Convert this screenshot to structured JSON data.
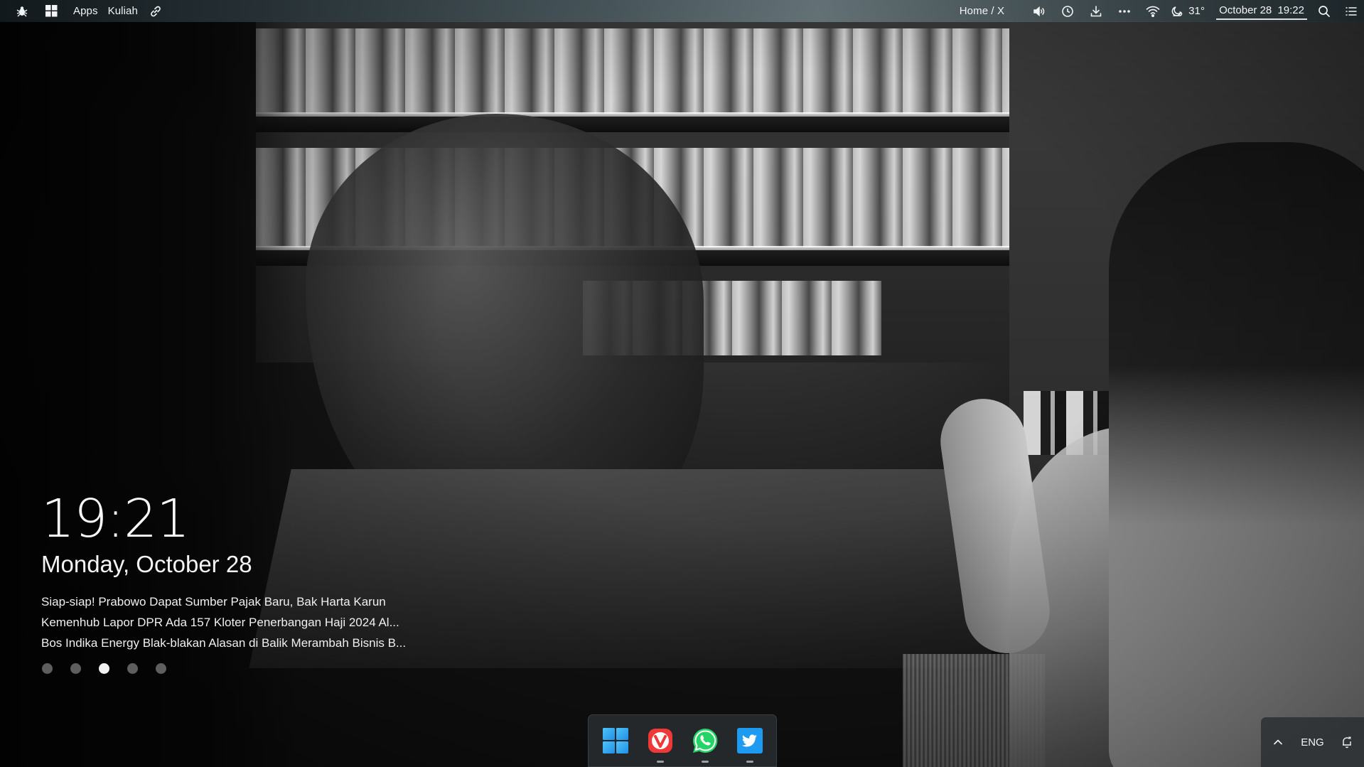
{
  "topbar": {
    "apps_label": "Apps",
    "kuliah_label": "Kuliah",
    "breadcrumb": "Home / X",
    "temperature": "31°",
    "date": "October 28",
    "time": "19:22"
  },
  "widget": {
    "time": "19:21",
    "date": "Monday, October 28",
    "news": [
      "Siap-siap! Prabowo Dapat Sumber Pajak Baru, Bak Harta Karun",
      "Kemenhub Lapor DPR Ada 157 Kloter Penerbangan Haji 2024 Al...",
      "Bos Indika Energy Blak-blakan Alasan di Balik Merambah Bisnis B..."
    ],
    "active_page": 3,
    "page_count": 5
  },
  "taskbar": {
    "apps": [
      {
        "icon": "windows-start-icon"
      },
      {
        "icon": "vivaldi-icon"
      },
      {
        "icon": "whatsapp-icon"
      },
      {
        "icon": "twitter-icon"
      }
    ]
  },
  "tray": {
    "language": "ENG"
  },
  "colors": {
    "windows_blue": "#1e90e8",
    "vivaldi_red": "#ef3939",
    "whatsapp_green": "#25d366",
    "twitter_blue": "#1d9bf0"
  }
}
